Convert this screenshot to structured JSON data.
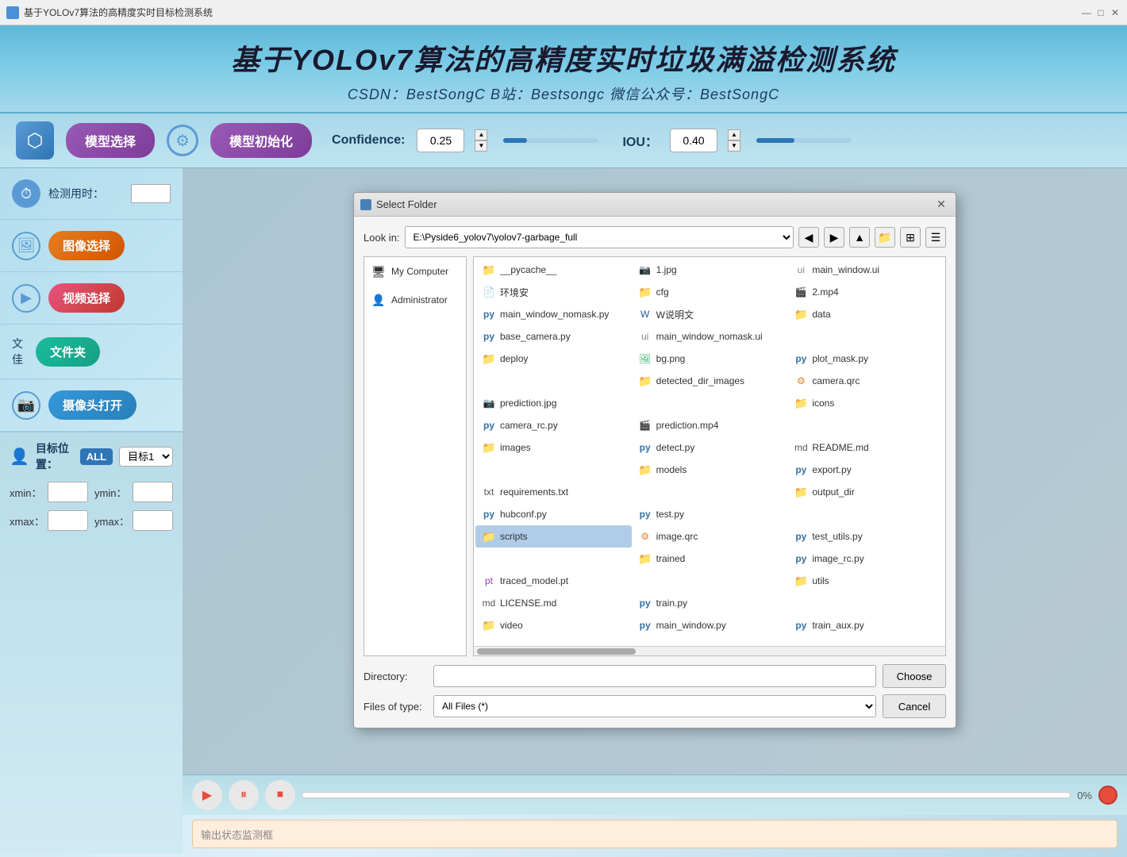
{
  "titlebar": {
    "text": "基于YOLOv7算法的高精度实时目标检测系统",
    "min": "—",
    "max": "□",
    "close": "✕"
  },
  "header": {
    "main_title": "基于YOLOv7算法的高精度实时垃圾满溢检测系统",
    "sub_title": "CSDN：BestSongC   B站：Bestsongc   微信公众号：BestSongC"
  },
  "toolbar": {
    "model_select": "模型选择",
    "model_init": "模型初始化",
    "confidence_label": "Confidence:",
    "confidence_value": "0.25",
    "iou_label": "IOU：",
    "iou_value": "0.40"
  },
  "sidebar": {
    "detect_time_label": "检测用时：",
    "image_select": "图像选择",
    "video_select": "视频选择",
    "folder_label": "文佳",
    "folder_btn": "文件夹",
    "camera_btn": "摄像头打开"
  },
  "target": {
    "label": "目标位置：",
    "all_badge": "ALL",
    "target1": "目标1",
    "xmin": "xmin：",
    "ymin": "ymin：",
    "xmax": "xmax：",
    "ymax": "ymax："
  },
  "bottom": {
    "progress_pct": "0%",
    "status_placeholder": "输出状态监测框"
  },
  "dialog": {
    "title": "Select Folder",
    "lookin_label": "Look in:",
    "lookin_path": "E:\\Pyside6_yolov7\\yolov7-garbage_full",
    "places": [
      {
        "name": "My Computer",
        "icon": "🖥"
      },
      {
        "name": "Administrator",
        "icon": "👤"
      }
    ],
    "files": [
      {
        "name": "__pycache__",
        "type": "folder"
      },
      {
        "name": "1.jpg",
        "type": "jpg"
      },
      {
        "name": "main_window.ui",
        "type": "ui"
      },
      {
        "name": "环境安",
        "type": "doc"
      },
      {
        "name": "cfg",
        "type": "folder"
      },
      {
        "name": "2.mp4",
        "type": "mp4"
      },
      {
        "name": "main_window_nomask.py",
        "type": "py"
      },
      {
        "name": "W说明文",
        "type": "word"
      },
      {
        "name": "data",
        "type": "folder"
      },
      {
        "name": "base_camera.py",
        "type": "py"
      },
      {
        "name": "main_window_nomask.ui",
        "type": "ui"
      },
      {
        "name": "",
        "type": ""
      },
      {
        "name": "deploy",
        "type": "folder"
      },
      {
        "name": "bg.png",
        "type": "png"
      },
      {
        "name": "plot_mask.py",
        "type": "py"
      },
      {
        "name": "",
        "type": ""
      },
      {
        "name": "detected_dir_images",
        "type": "folder"
      },
      {
        "name": "camera.qrc",
        "type": "qrc"
      },
      {
        "name": "prediction.jpg",
        "type": "jpg"
      },
      {
        "name": "",
        "type": ""
      },
      {
        "name": "icons",
        "type": "folder"
      },
      {
        "name": "camera_rc.py",
        "type": "py"
      },
      {
        "name": "prediction.mp4",
        "type": "mp4"
      },
      {
        "name": "",
        "type": ""
      },
      {
        "name": "images",
        "type": "folder"
      },
      {
        "name": "detect.py",
        "type": "py"
      },
      {
        "name": "README.md",
        "type": "md"
      },
      {
        "name": "",
        "type": ""
      },
      {
        "name": "models",
        "type": "folder"
      },
      {
        "name": "export.py",
        "type": "py"
      },
      {
        "name": "requirements.txt",
        "type": "txt"
      },
      {
        "name": "",
        "type": ""
      },
      {
        "name": "output_dir",
        "type": "folder"
      },
      {
        "name": "hubconf.py",
        "type": "py"
      },
      {
        "name": "test.py",
        "type": "py"
      },
      {
        "name": "",
        "type": ""
      },
      {
        "name": "scripts",
        "type": "folder"
      },
      {
        "name": "image.qrc",
        "type": "qrc"
      },
      {
        "name": "test_utils.py",
        "type": "py"
      },
      {
        "name": "",
        "type": ""
      },
      {
        "name": "trained",
        "type": "folder"
      },
      {
        "name": "image_rc.py",
        "type": "py"
      },
      {
        "name": "traced_model.pt",
        "type": "pt"
      },
      {
        "name": "",
        "type": ""
      },
      {
        "name": "utils",
        "type": "folder"
      },
      {
        "name": "LICENSE.md",
        "type": "md"
      },
      {
        "name": "train.py",
        "type": "py"
      },
      {
        "name": "",
        "type": ""
      },
      {
        "name": "video",
        "type": "folder"
      },
      {
        "name": "main_window.py",
        "type": "py"
      },
      {
        "name": "train_aux.py",
        "type": "py"
      },
      {
        "name": "",
        "type": ""
      }
    ],
    "directory_label": "Directory:",
    "directory_value": "",
    "choose_btn": "Choose",
    "cancel_btn": "Cancel",
    "filetype_label": "Files of type:",
    "filetype_value": "All Files (*)",
    "filetype_options": [
      "All Files (*)"
    ]
  }
}
